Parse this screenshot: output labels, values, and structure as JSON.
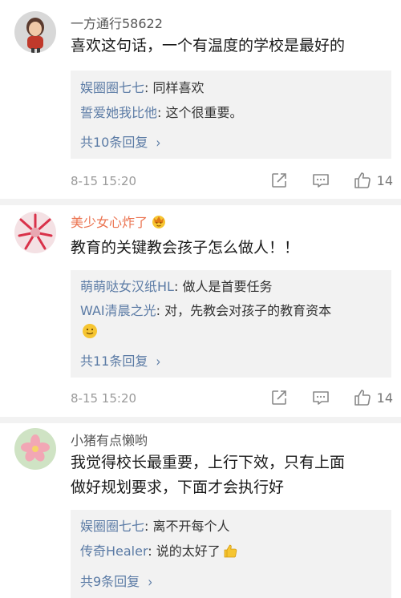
{
  "comments": [
    {
      "username": "一方通行58622",
      "text": "喜欢这句话，一个有温度的学校是最好的",
      "replies": [
        {
          "name": "娱圈圈七七",
          "sep": ": ",
          "text": "同样喜欢"
        },
        {
          "name": "誓爱她我比他",
          "sep": ": ",
          "text": "这个很重要。"
        }
      ],
      "more": "共10条回复",
      "time": "8-15 15:20",
      "likes": "14"
    },
    {
      "username": "美少女心炸了",
      "text": "教育的关键教会孩子怎么做人！！",
      "replies": [
        {
          "name": "萌萌哒女汉纸HL",
          "sep": ": ",
          "text": "做人是首要任务"
        },
        {
          "name": "WAI清晨之光",
          "sep": ": ",
          "text": "对，先教会对孩子的教育资本"
        }
      ],
      "more": "共11条回复",
      "time": "8-15 15:20",
      "likes": "14"
    },
    {
      "username": "小猪有点懒哟",
      "text_line1": "我觉得校长最重要，上行下效，只有上面",
      "text_line2": "做好规划要求，下面才会执行好",
      "replies": [
        {
          "name": "娱圈圈七七",
          "sep": ": ",
          "text": "离不开每个人"
        },
        {
          "name": "传奇Healer",
          "sep": ": ",
          "text": "说的太好了"
        }
      ],
      "more": "共9条回复"
    }
  ],
  "chevron": "›",
  "icons": {
    "share": "share-icon",
    "comment": "comment-icon",
    "like": "thumbs-up-icon",
    "emoji_smile": "smile-emoji",
    "emoji_thumb": "thumbs-up-emoji",
    "vip": "vip-badge-icon"
  },
  "colors": {
    "link": "#5b7ba5",
    "orange_name": "#eb7350",
    "reply_bg": "#f2f2f2",
    "meta": "#9a9a9a"
  }
}
